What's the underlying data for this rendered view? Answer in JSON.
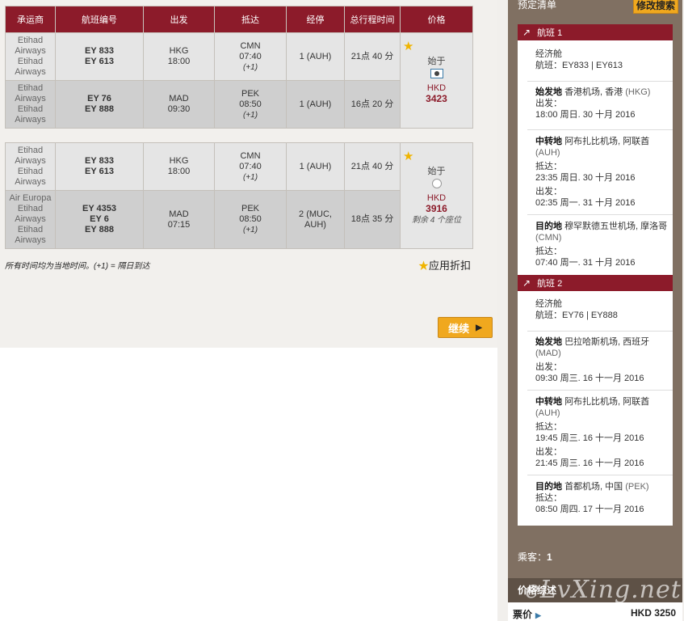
{
  "table": {
    "headers": [
      "承运商",
      "航班编号",
      "出发",
      "抵达",
      "经停",
      "总行程时间",
      "价格"
    ]
  },
  "options": [
    {
      "rows": [
        {
          "carriers": [
            "Etihad",
            "Airways",
            "Etihad",
            "Airways"
          ],
          "flights": [
            "EY 833",
            "EY 613"
          ],
          "dep_code": "HKG",
          "dep_time": "18:00",
          "arr_code": "CMN",
          "arr_time": "07:40",
          "arr_plus": "(+1)",
          "stops": "1 (AUH)",
          "duration": "21点 40 分"
        },
        {
          "carriers": [
            "Etihad",
            "Airways",
            "Etihad",
            "Airways"
          ],
          "flights": [
            "EY 76",
            "EY 888"
          ],
          "dep_code": "MAD",
          "dep_time": "09:30",
          "arr_code": "PEK",
          "arr_time": "08:50",
          "arr_plus": "(+1)",
          "stops": "1 (AUH)",
          "duration": "16点 20 分"
        }
      ],
      "price": {
        "from": "始于",
        "currency": "HKD",
        "amount": "3423",
        "seats": "",
        "selected": true
      }
    },
    {
      "rows": [
        {
          "carriers": [
            "Etihad",
            "Airways",
            "Etihad",
            "Airways"
          ],
          "flights": [
            "EY 833",
            "EY 613"
          ],
          "dep_code": "HKG",
          "dep_time": "18:00",
          "arr_code": "CMN",
          "arr_time": "07:40",
          "arr_plus": "(+1)",
          "stops": "1 (AUH)",
          "duration": "21点 40 分"
        },
        {
          "carriers": [
            "Air Europa",
            "Etihad",
            "Airways",
            "Etihad",
            "Airways"
          ],
          "flights": [
            "EY 4353",
            "EY 6",
            "EY 888"
          ],
          "dep_code": "MAD",
          "dep_time": "07:15",
          "arr_code": "PEK",
          "arr_time": "08:50",
          "arr_plus": "(+1)",
          "stops": "2 (MUC, AUH)",
          "duration": "18点 35 分"
        }
      ],
      "price": {
        "from": "始于",
        "currency": "HKD",
        "amount": "3916",
        "seats": "剩余 4 个座位",
        "selected": false
      }
    }
  ],
  "footnote": "所有时间均为当地时间。(+1) = 隔日到达",
  "discount_label": "应用折扣",
  "continue_label": "继续",
  "sidebar": {
    "title": "预定清单",
    "modify_label": "修改搜索",
    "segments": [
      {
        "label": "航班 1",
        "cabin": "经济舱",
        "flight_line": "航班：EY833 | EY613",
        "origin": {
          "key": "始发地",
          "name": "香港机场, 香港",
          "code": "(HKG)"
        },
        "dep_label": "出发：",
        "dep_time": "18:00 周日. 30 十月 2016",
        "transit": {
          "key": "中转地",
          "name": "阿布扎比机场, 阿联酋",
          "code": "(AUH)"
        },
        "t_arr_label": "抵达：",
        "t_arr_time": "23:35 周日. 30 十月 2016",
        "t_dep_label": "出发：",
        "t_dep_time": "02:35 周一. 31 十月 2016",
        "dest": {
          "key": "目的地",
          "name": "穆罕默德五世机场, 摩洛哥",
          "code": "(CMN)"
        },
        "arr_label": "抵达：",
        "arr_time": "07:40 周一. 31 十月 2016"
      },
      {
        "label": "航班 2",
        "cabin": "经济舱",
        "flight_line": "航班：EY76 | EY888",
        "origin": {
          "key": "始发地",
          "name": "巴拉哈斯机场, 西班牙",
          "code": "(MAD)"
        },
        "dep_label": "出发：",
        "dep_time": "09:30 周三. 16 十一月 2016",
        "transit": {
          "key": "中转地",
          "name": "阿布扎比机场, 阿联酋",
          "code": "(AUH)"
        },
        "t_arr_label": "抵达：",
        "t_arr_time": "19:45 周三. 16 十一月 2016",
        "t_dep_label": "出发：",
        "t_dep_time": "21:45 周三. 16 十一月 2016",
        "dest": {
          "key": "目的地",
          "name": "首都机场, 中国",
          "code": "(PEK)"
        },
        "arr_label": "抵达：",
        "arr_time": "08:50 周四. 17 十一月 2016"
      }
    ],
    "passengers_label": "乘客：",
    "passengers_count": "1",
    "price_summary_label": "价格综述",
    "fare_label": "票价",
    "fare_value": "HKD 3250"
  },
  "watermark": "eLvXing.net",
  "colors": {
    "header": "#8c1b2a",
    "accent": "#f0a81e",
    "sidebar": "#807062"
  },
  "icons": [
    "star-icon",
    "radio-selected-icon",
    "radio-icon",
    "arrow-northeast-icon",
    "play-arrow-icon"
  ]
}
